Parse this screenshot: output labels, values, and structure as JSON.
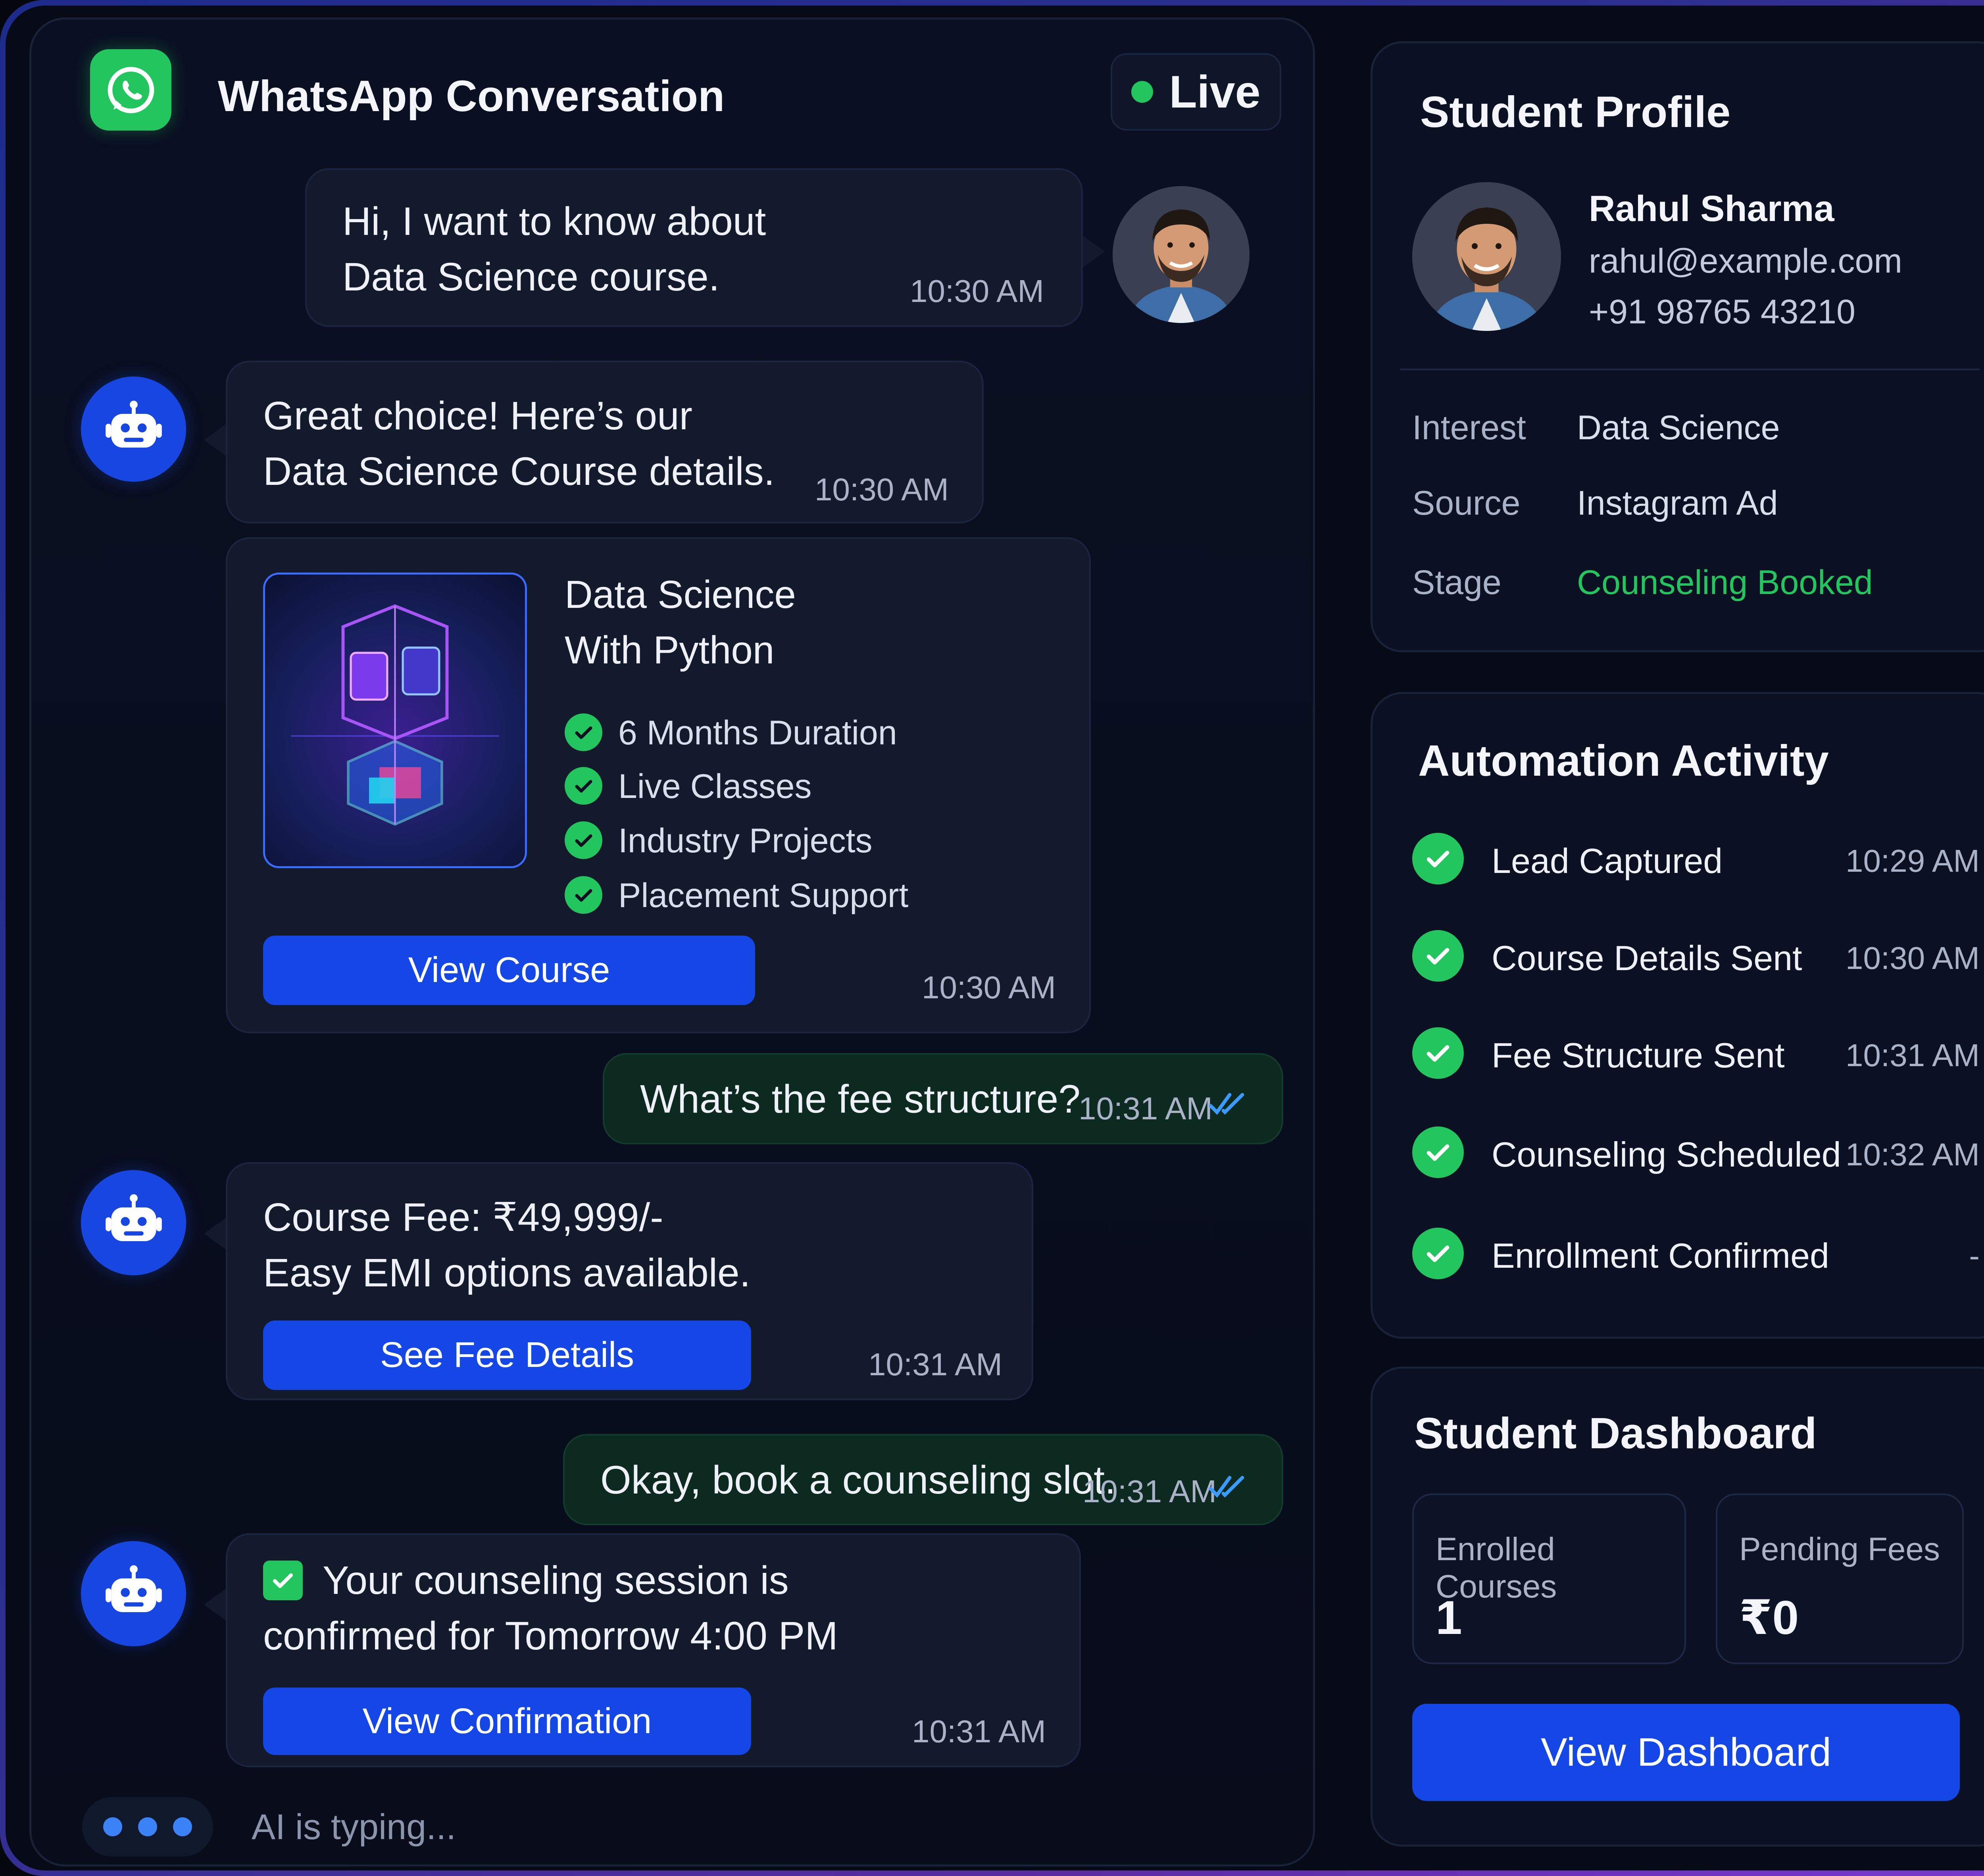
{
  "colors": {
    "accent": "#1546e6",
    "success": "#22c55e",
    "background": "#070b18",
    "panel": "#0b1122"
  },
  "chat": {
    "title": "WhatsApp Conversation",
    "status": "Live",
    "messages": [
      {
        "text": "Hi, I want to know about\nData Science course.",
        "time": "10:30 AM"
      },
      {
        "text": "Great choice! Here’s our\nData Science Course details.",
        "time": "10:30 AM"
      },
      {
        "course_title": "Data Science\nWith Python",
        "features": [
          "6 Months Duration",
          "Live Classes",
          "Industry Projects",
          "Placement Support"
        ],
        "button": "View Course",
        "time": "10:30 AM"
      },
      {
        "text": "What’s the fee structure?",
        "time": "10:31 AM"
      },
      {
        "text": "Course Fee: ₹49,999/-\nEasy EMI options available.",
        "button": "See Fee Details",
        "time": "10:31 AM"
      },
      {
        "text": "Okay, book a counseling slot.",
        "time": "10:31 AM"
      },
      {
        "text": "Your counseling session is\nconfirmed for Tomorrow 4:00 PM",
        "button": "View Confirmation",
        "time": "10:31 AM"
      }
    ],
    "typing": "AI is typing..."
  },
  "profile": {
    "title": "Student Profile",
    "name": "Rahul Sharma",
    "email": "rahul@example.com",
    "phone": "+91 98765 43210",
    "fields": [
      {
        "label": "Interest",
        "value": "Data Science"
      },
      {
        "label": "Source",
        "value": "Instagram Ad"
      },
      {
        "label": "Stage",
        "value": "Counseling Booked"
      }
    ]
  },
  "activity": {
    "title": "Automation Activity",
    "items": [
      {
        "label": "Lead Captured",
        "time": "10:29 AM"
      },
      {
        "label": "Course Details Sent",
        "time": "10:30 AM"
      },
      {
        "label": "Fee Structure Sent",
        "time": "10:31 AM"
      },
      {
        "label": "Counseling Scheduled",
        "time": "10:32 AM"
      },
      {
        "label": "Enrollment Confirmed",
        "time": "-"
      }
    ]
  },
  "dashboard": {
    "title": "Student Dashboard",
    "stats": [
      {
        "label": "Enrolled Courses",
        "value": "1"
      },
      {
        "label": "Pending Fees",
        "value": "₹0"
      }
    ],
    "button": "View Dashboard"
  }
}
